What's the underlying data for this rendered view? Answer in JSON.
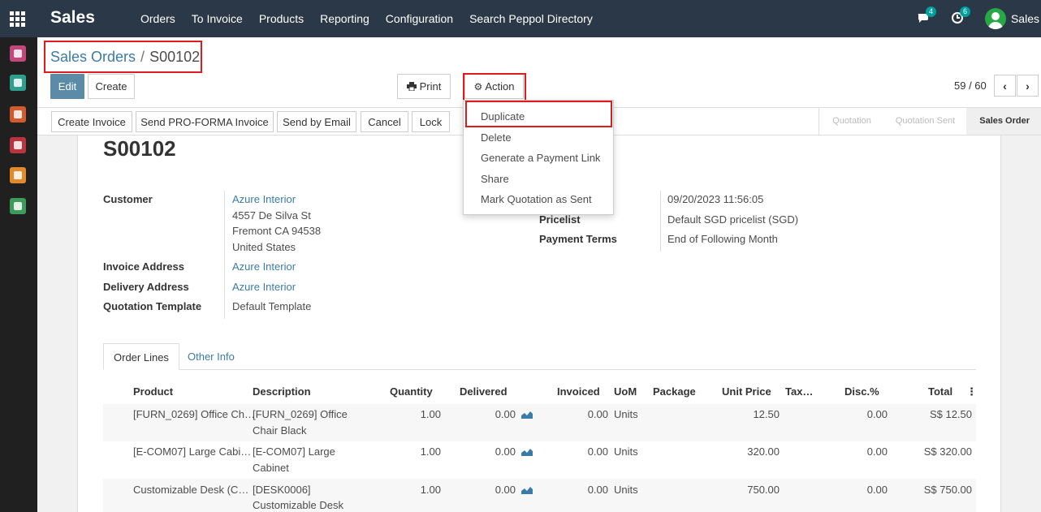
{
  "navbar": {
    "brand": "Sales",
    "menu": [
      "Orders",
      "To Invoice",
      "Products",
      "Reporting",
      "Configuration",
      "Search Peppol Directory"
    ],
    "messages_count": "4",
    "activities_count": "6",
    "user": "Sales"
  },
  "breadcrumb": {
    "parent": "Sales Orders",
    "separator": "/",
    "current": "S00102"
  },
  "buttons": {
    "edit": "Edit",
    "create": "Create",
    "print": "Print",
    "action": "Action"
  },
  "pager": {
    "text": "59 / 60"
  },
  "action_menu": [
    "Duplicate",
    "Delete",
    "Generate a Payment Link",
    "Share",
    "Mark Quotation as Sent"
  ],
  "statusbar": {
    "buttons": [
      "Create Invoice",
      "Send PRO-FORMA Invoice",
      "Send by Email",
      "Cancel",
      "Lock"
    ],
    "stages": [
      "Quotation",
      "Quotation Sent",
      "Sales Order"
    ]
  },
  "form": {
    "name": "S00102",
    "customer_label": "Customer",
    "customer_name": "Azure Interior",
    "customer_address": [
      "4557 De Silva St",
      "Fremont CA 94538",
      "United States"
    ],
    "invoice_address_label": "Invoice Address",
    "invoice_address": "Azure Interior",
    "delivery_address_label": "Delivery Address",
    "delivery_address": "Azure Interior",
    "template_label": "Quotation Template",
    "template": "Default Template",
    "date": "09/20/2023 11:56:05",
    "pricelist_label": "Pricelist",
    "pricelist": "Default SGD pricelist (SGD)",
    "payment_terms_label": "Payment Terms",
    "payment_terms": "End of Following Month"
  },
  "tabs": [
    "Order Lines",
    "Other Info"
  ],
  "lines": {
    "headers": [
      "Product",
      "Description",
      "Quantity",
      "Delivered",
      "Invoiced",
      "UoM",
      "Package",
      "Unit Price",
      "Tax…",
      "Disc.%",
      "Total"
    ],
    "rows": [
      {
        "product": "[FURN_0269] Office Ch…",
        "description": [
          "[FURN_0269] Office",
          "Chair Black"
        ],
        "quantity": "1.00",
        "delivered": "0.00",
        "invoiced": "0.00",
        "uom": "Units",
        "unit_price": "12.50",
        "discount": "0.00",
        "total": "S$ 12.50"
      },
      {
        "product": "[E-COM07] Large Cabi…",
        "description": [
          "[E-COM07] Large",
          "Cabinet"
        ],
        "quantity": "1.00",
        "delivered": "0.00",
        "invoiced": "0.00",
        "uom": "Units",
        "unit_price": "320.00",
        "discount": "0.00",
        "total": "S$ 320.00"
      },
      {
        "product": "Customizable Desk (C…",
        "description": [
          "[DESK0006]",
          "Customizable Desk"
        ],
        "quantity": "1.00",
        "delivered": "0.00",
        "invoiced": "0.00",
        "uom": "Units",
        "unit_price": "750.00",
        "discount": "0.00",
        "total": "S$ 750.00"
      }
    ]
  },
  "colors": {
    "navbar": "#2b3847",
    "primary": "#5b8ba6",
    "link": "#3b7ba8",
    "highlight": "#e01b1b",
    "badge": "#00a09d"
  }
}
